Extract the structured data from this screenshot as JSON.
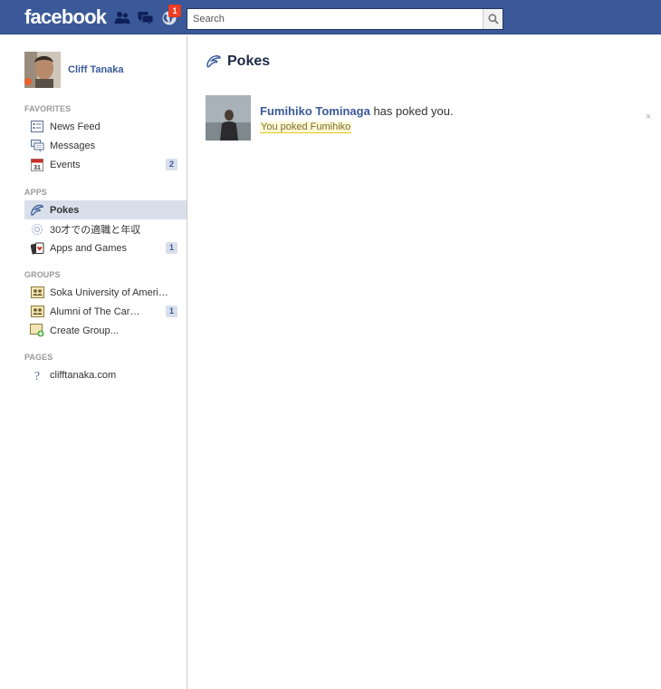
{
  "topbar": {
    "logo": "facebook",
    "notification_count": "1",
    "search_placeholder": "Search"
  },
  "profile": {
    "name": "Cliff Tanaka"
  },
  "sidebar": {
    "favorites_header": "FAVORITES",
    "favorites": [
      {
        "label": "News Feed",
        "icon": "news-feed-icon",
        "count": ""
      },
      {
        "label": "Messages",
        "icon": "messages-icon",
        "count": ""
      },
      {
        "label": "Events",
        "icon": "events-icon",
        "count": "2"
      }
    ],
    "apps_header": "APPS",
    "apps": [
      {
        "label": "Pokes",
        "icon": "poke-icon",
        "count": ""
      },
      {
        "label": "30才での適職と年収",
        "icon": "app-gear-icon",
        "count": ""
      },
      {
        "label": "Apps and Games",
        "icon": "apps-games-icon",
        "count": "1"
      }
    ],
    "groups_header": "GROUPS",
    "groups": [
      {
        "label": "Soka University of Ameri…",
        "icon": "group-icon",
        "count": ""
      },
      {
        "label": "Alumni of The Car…",
        "icon": "group-icon",
        "count": "1"
      },
      {
        "label": "Create Group...",
        "icon": "create-group-icon",
        "count": ""
      }
    ],
    "pages_header": "PAGES",
    "pages": [
      {
        "label": "clifftanaka.com",
        "icon": "question-mark-icon",
        "count": ""
      }
    ]
  },
  "main": {
    "title": "Pokes",
    "poke": {
      "name": "Fumihiko Tominaga",
      "message": " has poked you.",
      "status": "You poked Fumihiko",
      "close": "×"
    }
  },
  "colors": {
    "brand": "#3b5998",
    "selected_bg": "#d8dfea",
    "badge_red": "#f03d25"
  }
}
